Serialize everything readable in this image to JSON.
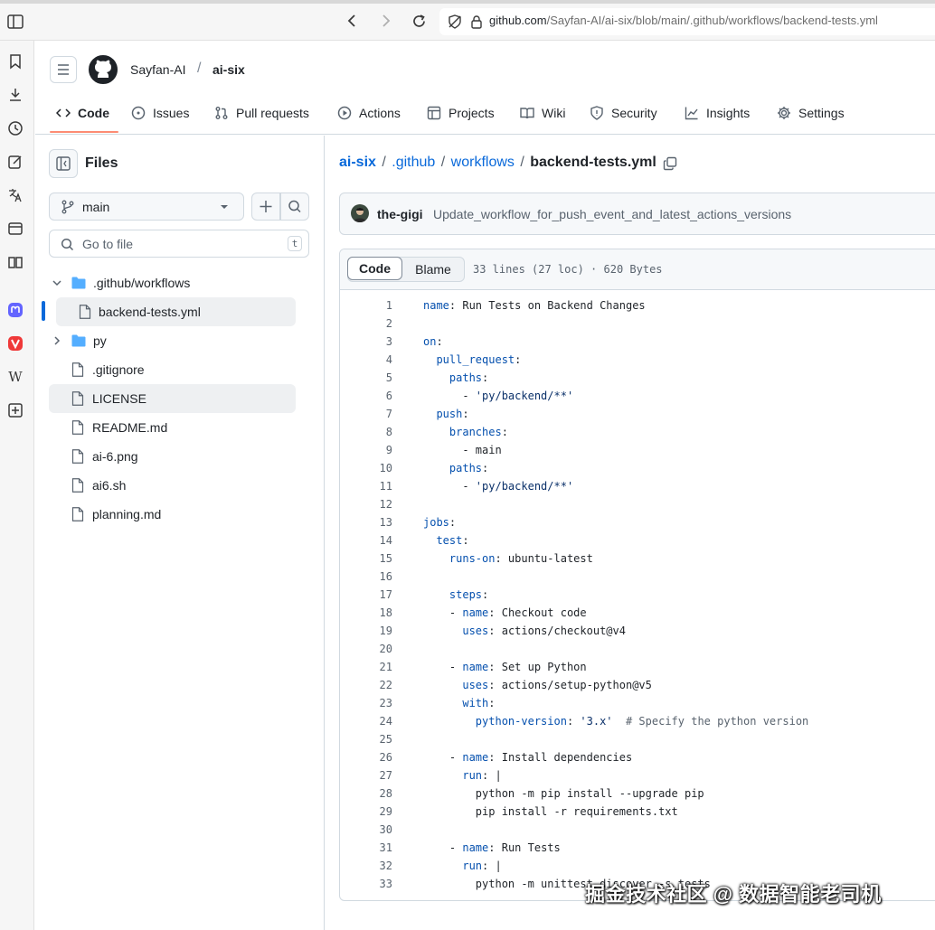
{
  "browser": {
    "url_host": "github.com",
    "url_path": "/Sayfan-AI/ai-six/blob/main/.github/workflows/backend-tests.yml"
  },
  "repo": {
    "owner": "Sayfan-AI",
    "separator": "/",
    "name": "ai-six"
  },
  "nav_tabs": [
    "Code",
    "Issues",
    "Pull requests",
    "Actions",
    "Projects",
    "Wiki",
    "Security",
    "Insights",
    "Settings"
  ],
  "files_panel": {
    "title": "Files",
    "branch": "main",
    "search_placeholder": "Go to file",
    "search_shortcut": "t",
    "tree": [
      {
        "name": ".github/workflows",
        "kind": "folder",
        "expanded": true
      },
      {
        "name": "backend-tests.yml",
        "kind": "file",
        "selected": true
      },
      {
        "name": "py",
        "kind": "folder",
        "expanded": false
      },
      {
        "name": ".gitignore",
        "kind": "file"
      },
      {
        "name": "LICENSE",
        "kind": "file",
        "hovered": true
      },
      {
        "name": "README.md",
        "kind": "file"
      },
      {
        "name": "ai-6.png",
        "kind": "file"
      },
      {
        "name": "ai6.sh",
        "kind": "file"
      },
      {
        "name": "planning.md",
        "kind": "file"
      }
    ]
  },
  "breadcrumb": {
    "parts": [
      "ai-six",
      ".github",
      "workflows"
    ],
    "current": "backend-tests.yml"
  },
  "commit": {
    "author": "the-gigi",
    "message": "Update_workflow_for_push_event_and_latest_actions_versions"
  },
  "code_view": {
    "tab_code": "Code",
    "tab_blame": "Blame",
    "meta": "33 lines (27 loc) · 620 Bytes"
  },
  "code_lines": [
    "name: Run Tests on Backend Changes",
    "",
    "on:",
    "  pull_request:",
    "    paths:",
    "      - 'py/backend/**'",
    "  push:",
    "    branches:",
    "      - main",
    "    paths:",
    "      - 'py/backend/**'",
    "",
    "jobs:",
    "  test:",
    "    runs-on: ubuntu-latest",
    "",
    "    steps:",
    "    - name: Checkout code",
    "      uses: actions/checkout@v4",
    "",
    "    - name: Set up Python",
    "      uses: actions/setup-python@v5",
    "      with:",
    "        python-version: '3.x'  # Specify the python version",
    "",
    "    - name: Install dependencies",
    "      run: |",
    "        python -m pip install --upgrade pip",
    "        pip install -r requirements.txt",
    "",
    "    - name: Run Tests",
    "      run: |",
    "        python -m unittest discover -s tests"
  ],
  "watermark": "掘金技术社区 @ 数据智能老司机",
  "colors": {
    "link": "#0969da",
    "yaml_key": "#0550ae",
    "yaml_string": "#0a3069",
    "selected_indicator": "#0969da",
    "tab_underline": "#fd8c73"
  }
}
